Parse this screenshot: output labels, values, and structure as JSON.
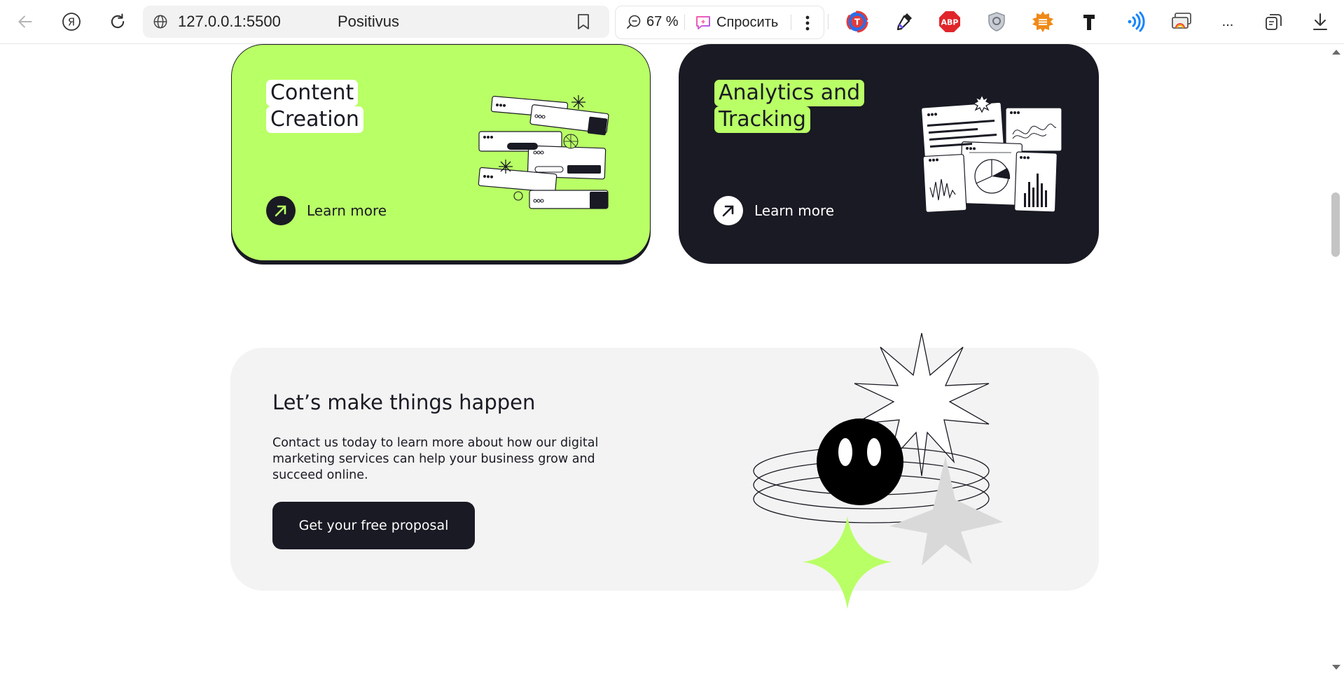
{
  "browser": {
    "url": "127.0.0.1:5500",
    "page_title": "Positivus",
    "zoom": "67 %",
    "ask_label": "Спросить",
    "more_label": "..."
  },
  "services": [
    {
      "title_line1": "Content",
      "title_line2": "Creation",
      "link": "Learn more",
      "theme": "green"
    },
    {
      "title_line1": "Analytics and",
      "title_line2": "Tracking",
      "link": "Learn more",
      "theme": "dark"
    }
  ],
  "cta": {
    "title": "Let’s make things happen",
    "text": "Contact us today to learn more about how our digital marketing services can help your business grow and succeed online.",
    "button": "Get your free proposal"
  },
  "colors": {
    "accent": "#B9FF66",
    "dark": "#191A23",
    "grey": "#F3F3F3"
  },
  "extensions": [
    "translate-icon",
    "eyedropper-icon",
    "adblock-plus-icon",
    "shield-icon",
    "sun-extension-icon",
    "t-extension-icon",
    "wifi-extension-icon",
    "screen-extension-icon"
  ]
}
